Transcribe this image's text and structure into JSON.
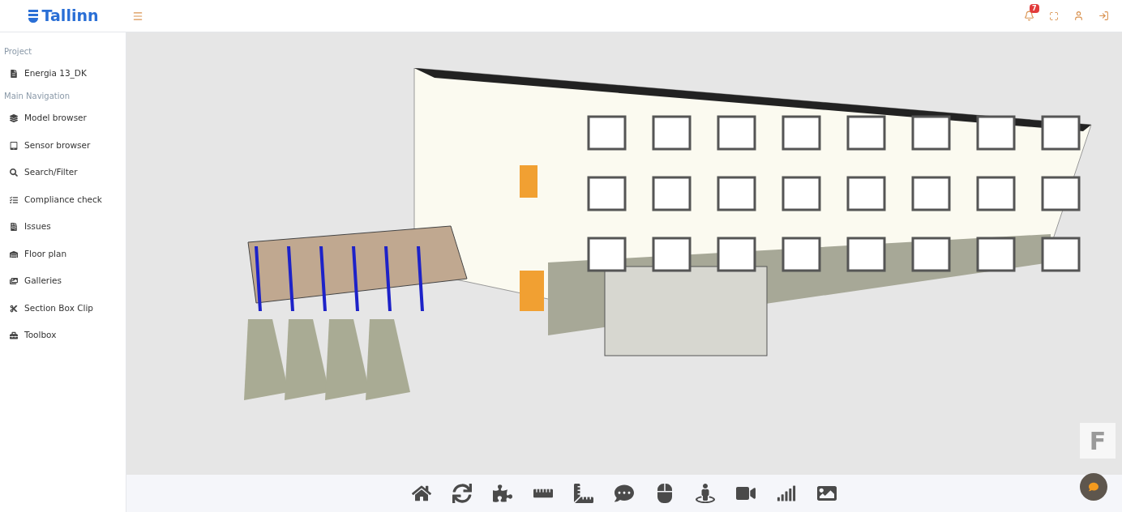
{
  "brand": {
    "name": "Tallinn"
  },
  "notifications": {
    "count": "7"
  },
  "sidebar": {
    "sections": [
      {
        "heading": "Project",
        "items": [
          {
            "label": "Energia 13_DK"
          }
        ]
      },
      {
        "heading": "Main Navigation",
        "items": [
          {
            "label": "Model browser"
          },
          {
            "label": "Sensor browser"
          },
          {
            "label": "Search/Filter"
          },
          {
            "label": "Compliance check"
          },
          {
            "label": "Issues"
          },
          {
            "label": "Floor plan"
          },
          {
            "label": "Galleries"
          },
          {
            "label": "Section Box Clip"
          },
          {
            "label": "Toolbox"
          }
        ]
      }
    ]
  },
  "view_cube": {
    "face": "F"
  }
}
